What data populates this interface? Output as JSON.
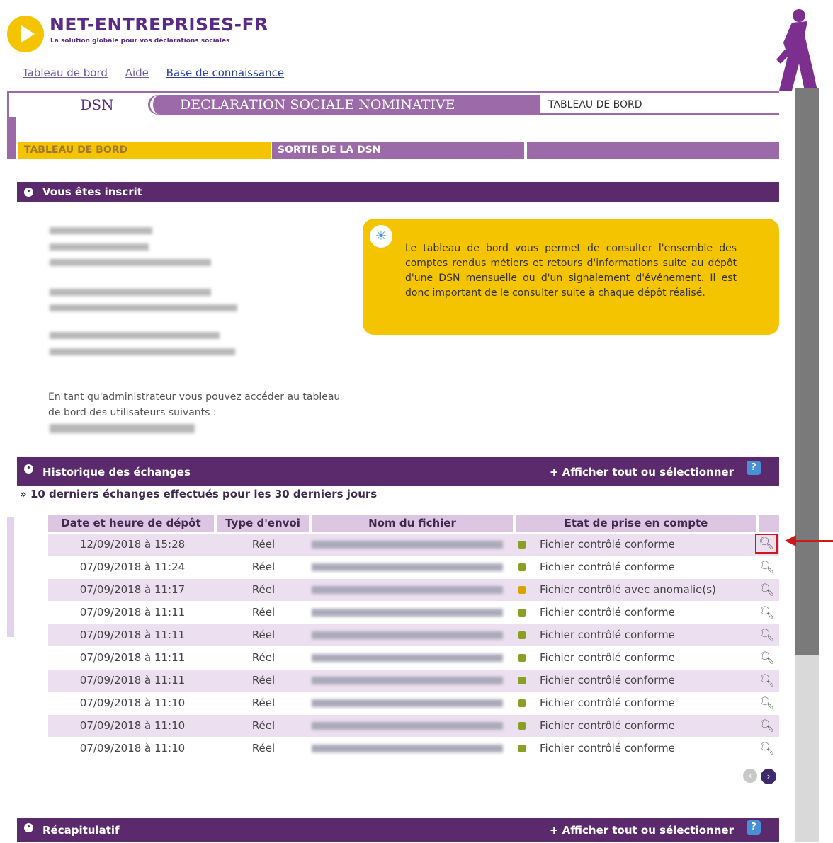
{
  "header": {
    "brand": "NET-ENTREPRISES-FR",
    "tagline": "La solution globale pour vos déclarations sociales",
    "links": [
      "Tableau de bord",
      "Aide",
      "Base de connaissance"
    ]
  },
  "banner": {
    "dsn": "DSN",
    "title": "DECLARATION SOCIALE NOMINATIVE",
    "crumb": "TABLEAU DE BORD"
  },
  "menu": {
    "tabs": [
      "TABLEAU DE BORD",
      "SORTIE DE LA DSN",
      ""
    ]
  },
  "inscrit": {
    "title": "Vous êtes inscrit",
    "info": "Le tableau de bord vous permet de consulter l'ensemble des comptes rendus métiers et retours d'informations suite au dépôt d'une DSN mensuelle ou d'un signalement d'événement. Il est donc important de le consulter suite à chaque dépôt réalisé.",
    "admin_text": "En tant qu'administrateur vous pouvez accéder au tableau de bord des utilisateurs suivants :"
  },
  "history": {
    "title": "Historique des échanges",
    "action": "+ Afficher tout ou sélectionner",
    "help": "?",
    "subtitle": "» 10 derniers échanges effectués pour les 30 derniers jours",
    "columns": [
      "Date et heure de dépôt",
      "Type d'envoi",
      "Nom du fichier",
      "Etat de prise en compte"
    ],
    "rows": [
      {
        "date": "12/09/2018 à 15:28",
        "type": "Réel",
        "status": "Fichier contrôlé conforme",
        "status_color": "#8aa024"
      },
      {
        "date": "07/09/2018 à 11:24",
        "type": "Réel",
        "status": "Fichier contrôlé conforme",
        "status_color": "#8aa024"
      },
      {
        "date": "07/09/2018 à 11:17",
        "type": "Réel",
        "status": "Fichier contrôlé avec anomalie(s)",
        "status_color": "#d9a400"
      },
      {
        "date": "07/09/2018 à 11:11",
        "type": "Réel",
        "status": "Fichier contrôlé conforme",
        "status_color": "#8aa024"
      },
      {
        "date": "07/09/2018 à 11:11",
        "type": "Réel",
        "status": "Fichier contrôlé conforme",
        "status_color": "#8aa024"
      },
      {
        "date": "07/09/2018 à 11:11",
        "type": "Réel",
        "status": "Fichier contrôlé conforme",
        "status_color": "#8aa024"
      },
      {
        "date": "07/09/2018 à 11:11",
        "type": "Réel",
        "status": "Fichier contrôlé conforme",
        "status_color": "#8aa024"
      },
      {
        "date": "07/09/2018 à 11:10",
        "type": "Réel",
        "status": "Fichier contrôlé conforme",
        "status_color": "#8aa024"
      },
      {
        "date": "07/09/2018 à 11:10",
        "type": "Réel",
        "status": "Fichier contrôlé conforme",
        "status_color": "#8aa024"
      },
      {
        "date": "07/09/2018 à 11:10",
        "type": "Réel",
        "status": "Fichier contrôlé conforme",
        "status_color": "#8aa024"
      }
    ]
  },
  "recap": {
    "title": "Récapitulatif",
    "action": "+ Afficher tout ou sélectionner",
    "help": "?"
  },
  "colors": {
    "purple_dark": "#5b2a6d",
    "purple_mid": "#9d6aa9",
    "yellow": "#f5c400",
    "row_alt": "#ecdff0",
    "highlight_red": "#cc1a1a"
  }
}
